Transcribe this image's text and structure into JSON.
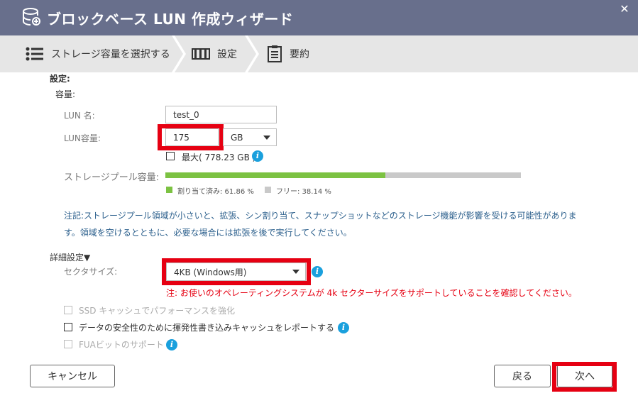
{
  "window": {
    "title": "ブロックベース LUN 作成ウィザード",
    "close_glyph": "✕"
  },
  "steps": [
    {
      "label": "ストレージ容量を選択する",
      "icon": "list-icon"
    },
    {
      "label": "設定",
      "icon": "settings-bars-icon"
    },
    {
      "label": "要約",
      "icon": "summary-doc-icon"
    }
  ],
  "settings": {
    "section_label": "設定:",
    "capacity_label": "容量:",
    "lun_name_label": "LUN 名:",
    "lun_name_value": "test_0",
    "lun_capacity_label": "LUN容量:",
    "lun_capacity_value": "175",
    "unit_value": "GB",
    "max_label": "最大( 778.23 GB )",
    "pool_label": "ストレージプール容量:",
    "pool_used_fraction": 0.6186,
    "allocated_label": "割り当て済み: 61.86 %",
    "free_label": "フリー: 38.14 %",
    "note_line1": "注記:ストレージプール領域が小さいと、拡張、シン割り当て、スナップショットなどのストレージ機能が影響を受ける可能性がありま",
    "note_line2": "す。領域を空けるとともに、必要な場合には拡張を後で実行してください。"
  },
  "advanced": {
    "section_label": "詳細設定▼",
    "sector_label": "セクタサイズ:",
    "sector_value": "4KB (Windows用)",
    "warning": "注: お使いのオペレーティングシステムが 4k セクターサイズをサポートしていることを確認してください。",
    "ssd_cache_label": "SSD キャッシュでパフォーマンスを強化",
    "write_cache_label": "データの安全性のために揮発性書き込みキャッシュをレポートする",
    "fua_label": "FUAビットのサポート"
  },
  "buttons": {
    "cancel": "キャンセル",
    "back": "戻る",
    "next": "次へ"
  },
  "colors": {
    "titlebar": "#686f8c",
    "allocated": "#7cc242",
    "free": "#c9c9c9",
    "highlight": "#e60012",
    "info": "#1aa0dd"
  }
}
